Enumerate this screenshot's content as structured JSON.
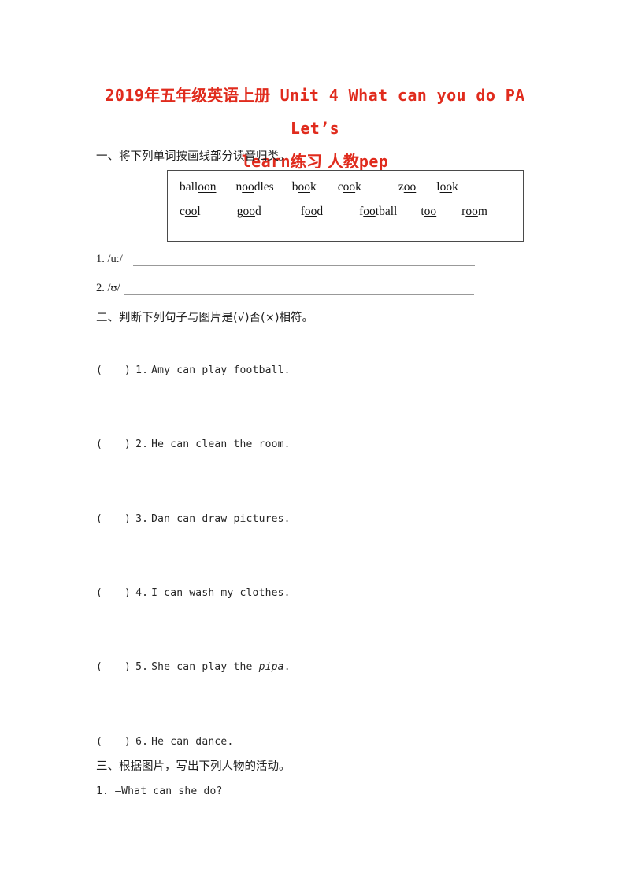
{
  "document": {
    "title_line_1_prefix": "2019",
    "title_line_1_cn": "年五年级英语上册",
    "title_line_1_en": "Unit 4 What can you do PA Let’s",
    "title_line_2_en": "learn",
    "title_line_2_cn": "练习 人教",
    "title_line_2_suffix": "pep",
    "title_color": "#e02b1d"
  },
  "section_one": {
    "heading": "一、将下列单词按画线部分读音归类。",
    "word_box": {
      "rows": [
        [
          {
            "pre": "ball",
            "underlined": "oon",
            "post": ""
          },
          {
            "pre": "n",
            "underlined": "oo",
            "post": "dles"
          },
          {
            "pre": "b",
            "underlined": "oo",
            "post": "k"
          },
          {
            "pre": "c",
            "underlined": "oo",
            "post": "k"
          },
          {
            "pre": "z",
            "underlined": "oo",
            "post": ""
          },
          {
            "pre": "l",
            "underlined": "oo",
            "post": "k"
          }
        ],
        [
          {
            "pre": "c",
            "underlined": "oo",
            "post": "l"
          },
          {
            "pre": "g",
            "underlined": "oo",
            "post": "d"
          },
          {
            "pre": "f",
            "underlined": "oo",
            "post": "d"
          },
          {
            "pre": "f",
            "underlined": "oo",
            "post": "tball"
          },
          {
            "pre": "t",
            "underlined": "oo",
            "post": ""
          },
          {
            "pre": "r",
            "underlined": "oo",
            "post": "m"
          }
        ]
      ]
    },
    "answers": [
      {
        "number": "1.",
        "phoneme": "/uː/",
        "value": ""
      },
      {
        "number": "2.",
        "phoneme": "/ʊ/",
        "value": ""
      }
    ]
  },
  "section_two": {
    "heading": "二、判断下列句子与图片是(√)否(×)相符。",
    "items": [
      {
        "paren_open": "(",
        "paren_close": ")",
        "number": "1.",
        "sentence": "Amy can play football.",
        "italic": "",
        "sentence_tail": ""
      },
      {
        "paren_open": "(",
        "paren_close": ")",
        "number": "2.",
        "sentence": "He can clean the room.",
        "italic": "",
        "sentence_tail": ""
      },
      {
        "paren_open": "(",
        "paren_close": ")",
        "number": "3.",
        "sentence": "Dan can draw pictures.",
        "italic": "",
        "sentence_tail": ""
      },
      {
        "paren_open": "(",
        "paren_close": ")",
        "number": "4.",
        "sentence": "I can wash my clothes.",
        "italic": "",
        "sentence_tail": ""
      },
      {
        "paren_open": "(",
        "paren_close": ")",
        "number": "5.",
        "sentence": "She can play the ",
        "italic": "pipa",
        "sentence_tail": "."
      },
      {
        "paren_open": "(",
        "paren_close": ")",
        "number": "6.",
        "sentence": "He can dance.",
        "italic": "",
        "sentence_tail": ""
      }
    ]
  },
  "section_three": {
    "heading": "三、根据图片，写出下列人物的活动。",
    "items": [
      {
        "number": "1.",
        "text": "—What can she do?"
      }
    ]
  }
}
